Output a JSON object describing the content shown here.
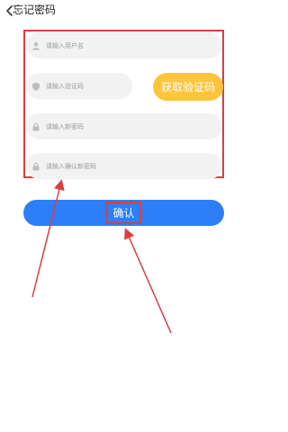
{
  "header": {
    "title": "忘记密码"
  },
  "form": {
    "username_placeholder": "请输入用户名",
    "code_placeholder": "请输入验证码",
    "get_code_label": "获取验证码",
    "new_password_placeholder": "请输入新密码",
    "confirm_password_placeholder": "请输入确认新密码"
  },
  "actions": {
    "confirm_label": "确认"
  },
  "colors": {
    "accent_blue": "#2d7ff9",
    "code_button_yellow": "#ffc53a",
    "annotation_red": "#e23b3b",
    "field_bg": "#f2f2f2"
  },
  "icons": {
    "back": "chevron-left-icon",
    "user": "user-icon",
    "code": "shield-icon",
    "lock": "lock-icon"
  }
}
